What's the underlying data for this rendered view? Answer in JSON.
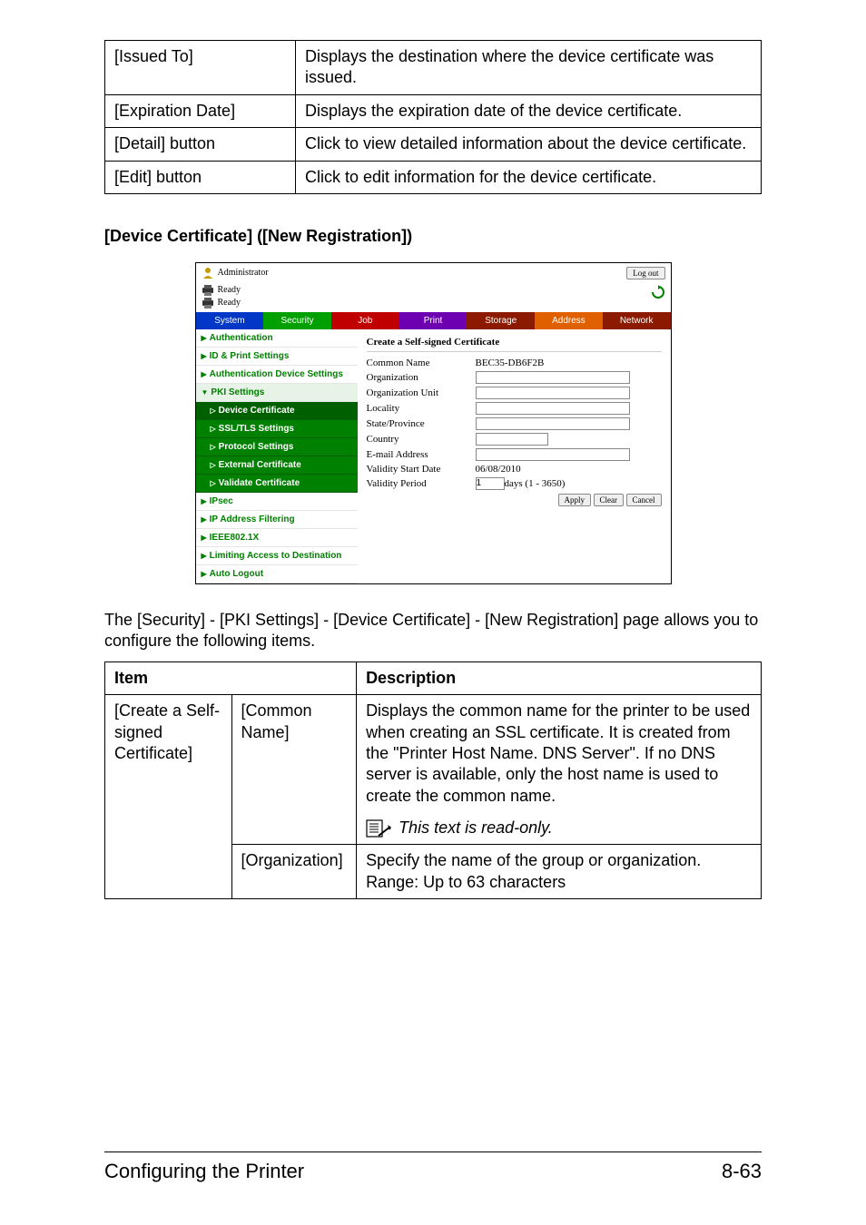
{
  "cert_table": {
    "rows": [
      {
        "label": "[Issued To]",
        "desc": "Displays the destination where the device certificate was issued."
      },
      {
        "label": "[Expiration Date]",
        "desc": "Displays the expiration date of the device certificate."
      },
      {
        "label": "[Detail] button",
        "desc": "Click to view detailed information about the device certificate."
      },
      {
        "label": "[Edit] button",
        "desc": "Click to edit information for the device certificate."
      }
    ]
  },
  "section_heading": "[Device Certificate] ([New Registration])",
  "ui": {
    "admin": "Administrator",
    "logout": "Log out",
    "ready1": "Ready",
    "ready2": "Ready",
    "tabs": [
      "System",
      "Security",
      "Job",
      "Print",
      "Storage",
      "Address",
      "Network"
    ],
    "side_main": [
      "Authentication",
      "ID & Print Settings",
      "Authentication Device Settings",
      "PKI Settings"
    ],
    "side_sub": [
      "Device Certificate",
      "SSL/TLS Settings",
      "Protocol Settings",
      "External Certificate",
      "Validate Certificate"
    ],
    "side_tail": [
      "IPsec",
      "IP Address Filtering",
      "IEEE802.1X",
      "Limiting Access to Destination",
      "Auto Logout"
    ],
    "panel_title": "Create a Self-signed Certificate",
    "fields": {
      "common_name_label": "Common Name",
      "common_name_value": "BEC35-DB6F2B",
      "organization_label": "Organization",
      "org_unit_label": "Organization Unit",
      "locality_label": "Locality",
      "state_label": "State/Province",
      "country_label": "Country",
      "email_label": "E-mail Address",
      "start_label": "Validity Start Date",
      "start_value": "06/08/2010",
      "period_label": "Validity Period",
      "period_value": "1",
      "period_suffix": "days (1 - 3650)"
    },
    "buttons": {
      "apply": "Apply",
      "clear": "Clear",
      "cancel": "Cancel"
    }
  },
  "body_text": "The [Security] - [PKI Settings] - [Device Certificate] - [New Registration] page allows you to configure the following items.",
  "item_table": {
    "head_item": "Item",
    "head_desc": "Description",
    "group_label": "[Create a Self-signed Certificate]",
    "rows": [
      {
        "sub": "[Common Name]",
        "desc_main": "Displays the common name for the printer to be used when creating an SSL certificate. It is created from the \"Printer Host Name. DNS Server\". If no DNS server is available, only the host name is used to create the common name.",
        "note": "This text is read-only."
      },
      {
        "sub": "[Organization]",
        "desc_main": "Specify the name of the group or organization.\nRange: Up to 63 characters"
      }
    ]
  },
  "footer": {
    "left": "Configuring the Printer",
    "right": "8-63"
  }
}
